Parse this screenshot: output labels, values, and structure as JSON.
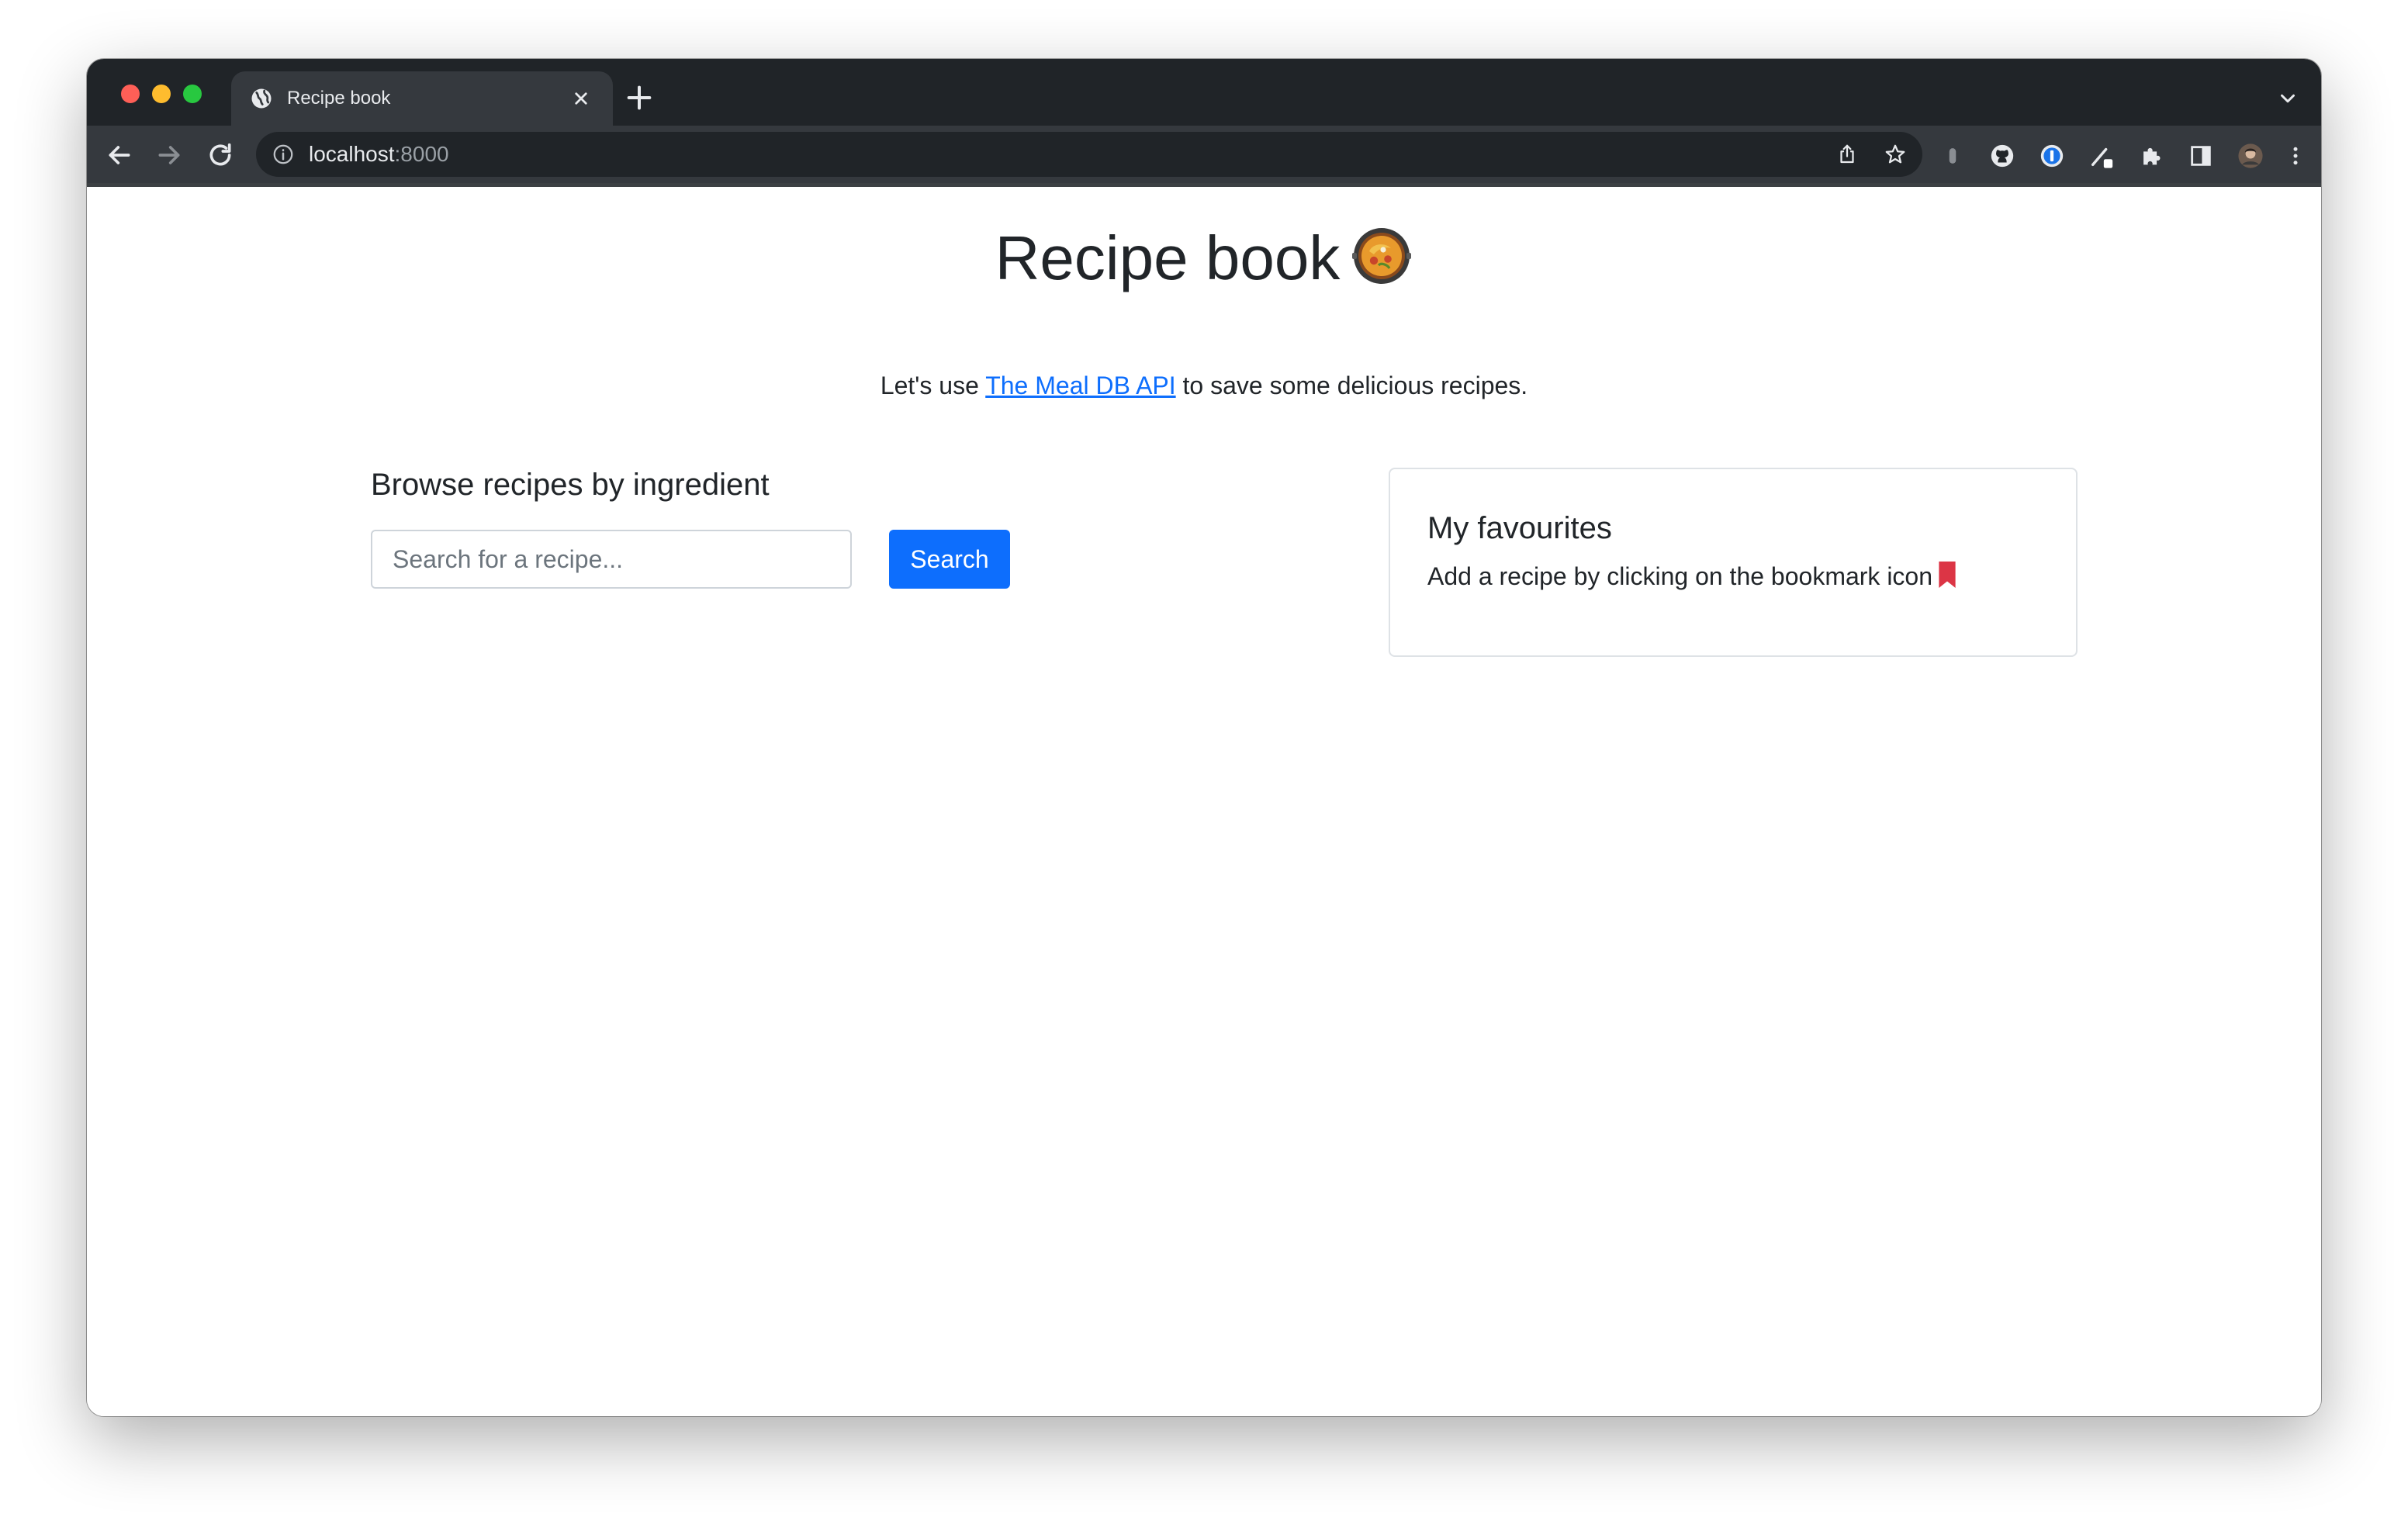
{
  "browser": {
    "tab": {
      "title": "Recipe book",
      "favicon": "globe-icon"
    },
    "address_bar": {
      "host": "localhost",
      "port": ":8000"
    },
    "icons": {
      "back": "arrow-left-icon",
      "forward": "arrow-right-icon",
      "reload": "reload-icon",
      "share": "share-icon",
      "bookmark_star": "star-icon",
      "extensions": "puzzle-icon",
      "side_panel": "side-panel-icon",
      "menu": "kebab-menu-icon"
    },
    "colors": {
      "tabbar": "#202428",
      "toolbar": "#35393e"
    }
  },
  "page": {
    "title": "Recipe book",
    "title_icon": "paella-pan-icon",
    "subtitle": {
      "before": "Let's use ",
      "link": "The Meal DB API",
      "after": " to save some delicious recipes."
    },
    "browse": {
      "heading": "Browse recipes by ingredient",
      "search_placeholder": "Search for a recipe...",
      "search_value": "",
      "search_button": "Search"
    },
    "favourites": {
      "title": "My favourites",
      "hint": "Add a recipe by clicking on the bookmark icon",
      "hint_icon": "bookmark-icon"
    },
    "colors": {
      "primary": "#0d6efd",
      "text": "#212529",
      "bookmark": "#dc3545"
    }
  }
}
